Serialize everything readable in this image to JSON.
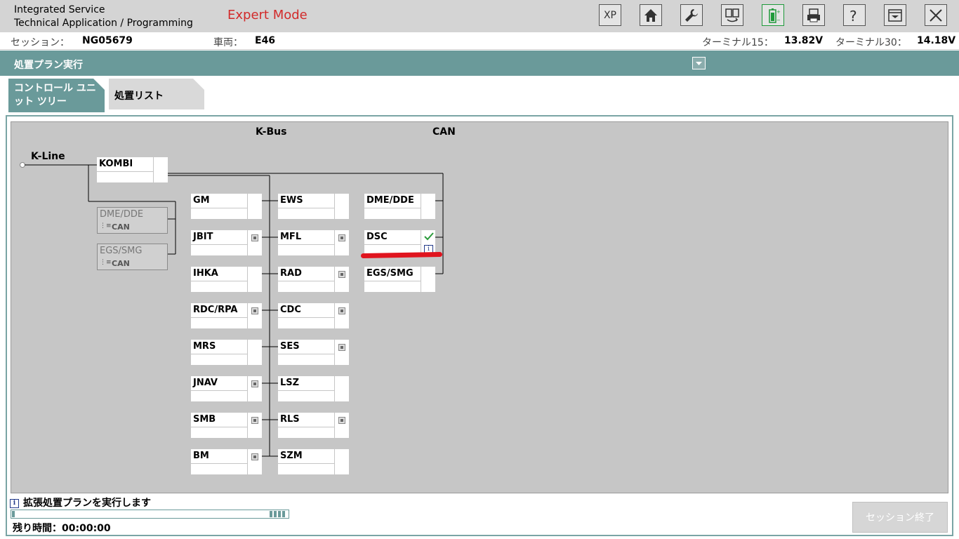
{
  "app": {
    "title_line1": "Integrated Service",
    "title_line2": "Technical Application / Programming",
    "mode": "Expert Mode"
  },
  "toolbar": {
    "xp_label": "XP",
    "icons": [
      "home-icon",
      "wrench-icon",
      "swap-icon",
      "battery-icon",
      "printer-icon",
      "help-icon",
      "collapse-icon",
      "close-icon"
    ]
  },
  "session": {
    "session_label": "セッション：",
    "session_value": "NG05679",
    "vehicle_label": "車両：",
    "vehicle_value": "E46",
    "t15_label": "ターミナル15：",
    "t15_value": "13.82V",
    "t30_label": "ターミナル30：",
    "t30_value": "14.18V"
  },
  "section": {
    "title": "処置プラン実行"
  },
  "tabs": {
    "control_unit_tree": "コントロール ユニット ツリー",
    "action_list": "処置リスト"
  },
  "diagram": {
    "kbus_label": "K-Bus",
    "can_label": "CAN",
    "kline_label": "K-Line",
    "kombi": "KOMBI",
    "dim_units": [
      {
        "name": "DME/DDE",
        "sub": "CAN"
      },
      {
        "name": "EGS/SMG",
        "sub": "CAN"
      }
    ],
    "kbus_left": [
      "GM",
      "JBIT",
      "IHKA",
      "RDC/RPA",
      "MRS",
      "JNAV",
      "SMB",
      "BM"
    ],
    "kbus_right": [
      "EWS",
      "MFL",
      "RAD",
      "CDC",
      "SES",
      "LSZ",
      "RLS",
      "SZM"
    ],
    "can_units": [
      "DME/DDE",
      "DSC",
      "EGS/SMG"
    ]
  },
  "status": {
    "message": "拡張処置プランを実行します",
    "remaining": "残り時間：00:00:00",
    "end_session": "セッション終了"
  },
  "colors": {
    "teal": "#6a9a9a",
    "mode_red": "#d22a2a",
    "check_green": "#2a9a3a",
    "annotation_red": "#e0141e"
  }
}
